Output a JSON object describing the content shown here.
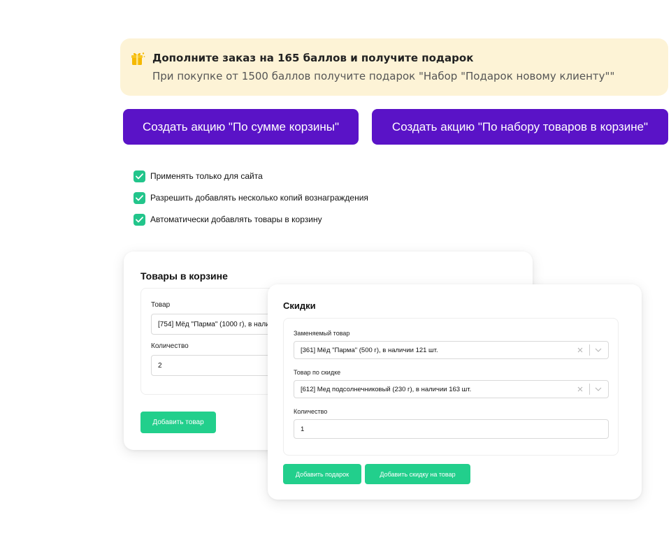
{
  "banner": {
    "icon": "gift-icon",
    "title": "Дополните заказ на 165 баллов и получите подарок",
    "subtitle": "При покупке от 1500 баллов получите подарок \"Набор \"Подарок новому клиенту\"\""
  },
  "promo_buttons": {
    "cart_sum": "Создать акцию \"По сумме корзины\"",
    "cart_set": "Создать акцию \"По набору товаров в корзине\""
  },
  "options": [
    {
      "label": "Применять только для сайта",
      "checked": true
    },
    {
      "label": "Разрешить добавлять несколько копий вознаграждения",
      "checked": true
    },
    {
      "label": "Автоматически добавлять товары в корзину",
      "checked": true
    }
  ],
  "cart_card": {
    "title": "Товары в корзине",
    "product_label": "Товар",
    "product_value": "[754] Мёд \"Парма\" (1000 г), в наличии",
    "quantity_label": "Количество",
    "quantity_value": "2",
    "add_button": "Добавить товар"
  },
  "discount_card": {
    "title": "Скидки",
    "replaced_label": "Заменяемый товар",
    "replaced_value": "[361] Мёд \"Парма\" (500 г), в наличии 121 шт.",
    "discount_label": "Товар по скидке",
    "discount_value": "[612] Мед подсолнечниковый (230 г), в наличии 163 шт.",
    "quantity_label": "Количество",
    "quantity_value": "1",
    "add_gift_button": "Добавить подарок",
    "add_discount_button": "Добавить скидку на товар"
  },
  "colors": {
    "purple": "#5a13c7",
    "green": "#22cf8c",
    "banner_bg": "#fdf3d6",
    "gift_yellow": "#f5b800"
  }
}
